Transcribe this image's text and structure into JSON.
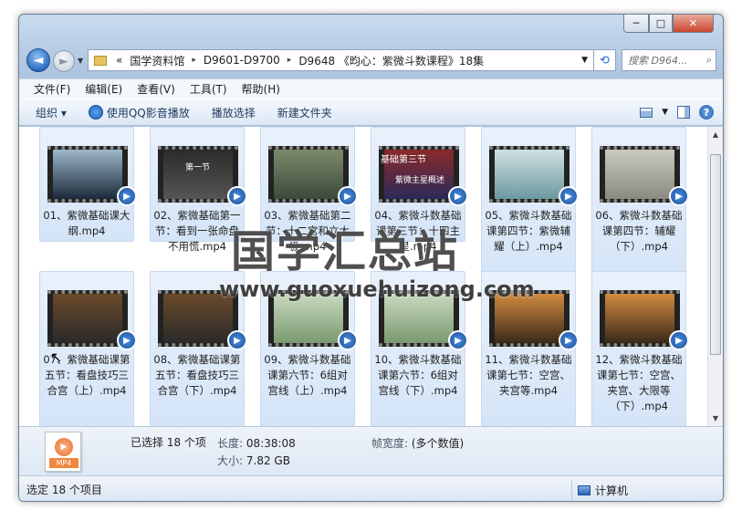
{
  "window": {
    "controls": {
      "minimize": "─",
      "maximize": "□",
      "close": "✕"
    }
  },
  "nav": {
    "back_icon": "◄",
    "forward_icon": "►"
  },
  "address": {
    "overflow": "«",
    "segments": [
      "国学资料馆",
      "D9601-D9700",
      "D9648 《昀心：紫微斗数课程》18集"
    ],
    "separator": "▸"
  },
  "search": {
    "placeholder": "搜索 D964..."
  },
  "menu": [
    "文件(F)",
    "编辑(E)",
    "查看(V)",
    "工具(T)",
    "帮助(H)"
  ],
  "toolbar": {
    "organize": "组织 ▾",
    "play_qq": "使用QQ影音播放",
    "playlist": "播放选择",
    "new_folder": "新建文件夹",
    "help": "?"
  },
  "files": [
    {
      "name": "01、紫微基础课大纲.mp4",
      "colors": [
        "#9db7c9",
        "#1b2a3a"
      ]
    },
    {
      "name": "02、紫微基础第一节：看到一张命盘不用慌.mp4",
      "colors": [
        "#2b2b2b",
        "#555"
      ]
    },
    {
      "name": "03、紫微基础第二节：十二宫和立太极.mp4",
      "colors": [
        "#7b8a6a",
        "#3b4a3a"
      ]
    },
    {
      "name": "04、紫微斗数基础课第三节：十四主星.mp4",
      "colors": [
        "#8a2a2a",
        "#2a2a5a"
      ]
    },
    {
      "name": "05、紫微斗数基础课第四节：紫微辅耀（上）.mp4",
      "colors": [
        "#cfe0e0",
        "#6a9aa0"
      ]
    },
    {
      "name": "06、紫微斗数基础课第四节：辅耀（下）.mp4",
      "colors": [
        "#c9c9bf",
        "#8a8a80"
      ]
    },
    {
      "name": "07、紫微基础课第五节：看盘技巧三合宫（上）.mp4",
      "colors": [
        "#6a4a2a",
        "#2a2a2a"
      ]
    },
    {
      "name": "08、紫微基础课第五节：看盘技巧三合宫（下）.mp4",
      "colors": [
        "#6a4a2a",
        "#2a2a2a"
      ]
    },
    {
      "name": "09、紫微斗数基础课第六节：6组对宫线（上）.mp4",
      "colors": [
        "#c9d9c0",
        "#7a9a70"
      ]
    },
    {
      "name": "10、紫微斗数基础课第六节：6组对宫线（下）.mp4",
      "colors": [
        "#c9d9c0",
        "#7a9a70"
      ]
    },
    {
      "name": "11、紫微斗数基础课第七节：空宫、夹宫等.mp4",
      "colors": [
        "#d08a40",
        "#3a2a1a"
      ]
    },
    {
      "name": "12、紫微斗数基础课第七节：空宫、夹宫、大限等（下）.mp4",
      "colors": [
        "#d08a40",
        "#3a2a1a"
      ]
    }
  ],
  "thumb_text": {
    "t02": "第一节",
    "t04a": "基础第三节",
    "t04b": "紫微主星概述"
  },
  "details": {
    "selected": "已选择 18 个项",
    "length_label": "长度:",
    "length_value": "08:38:08",
    "size_label": "大小:",
    "size_value": "7.82 GB",
    "framewidth_label": "帧宽度:",
    "framewidth_value": "(多个数值)",
    "icon_label": "MP4"
  },
  "status": {
    "left": "选定 18 个项目",
    "computer": "计算机"
  },
  "watermark": {
    "title": "国学汇总站",
    "url": "www.guoxuehuizong.com"
  }
}
